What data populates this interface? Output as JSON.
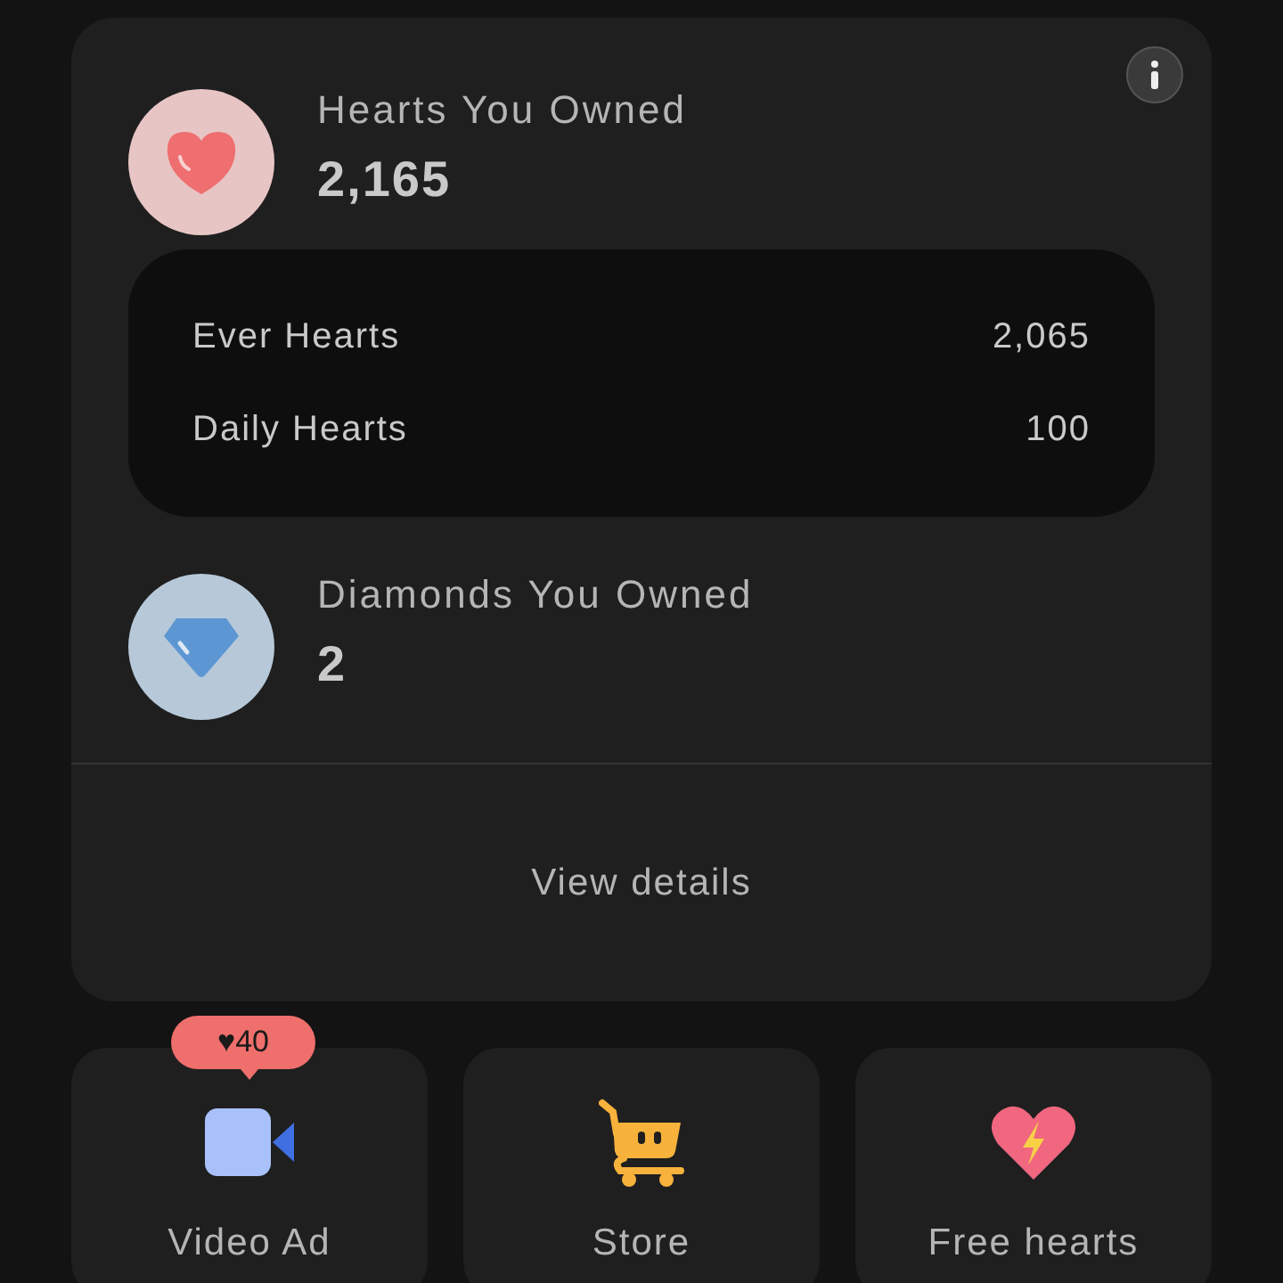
{
  "hearts": {
    "label": "Hearts You Owned",
    "value": "2,165",
    "breakdown": [
      {
        "label": "Ever Hearts",
        "value": "2,065"
      },
      {
        "label": "Daily Hearts",
        "value": "100"
      }
    ]
  },
  "diamonds": {
    "label": "Diamonds You Owned",
    "value": "2"
  },
  "view_details": "View details",
  "actions": [
    {
      "kind": "video",
      "label": "Video Ad",
      "badge": "♥40"
    },
    {
      "kind": "store",
      "label": "Store"
    },
    {
      "kind": "free",
      "label": "Free hearts"
    }
  ]
}
